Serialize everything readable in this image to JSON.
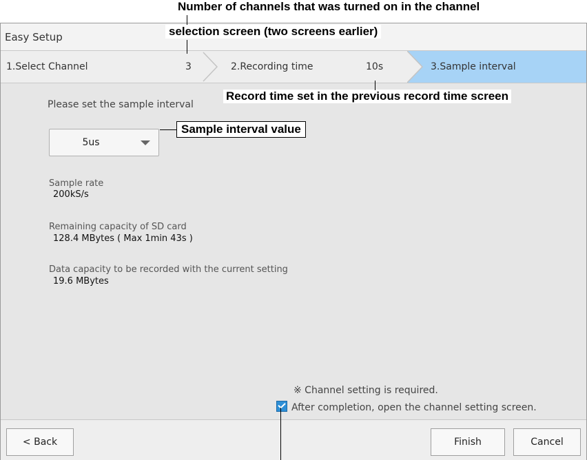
{
  "window": {
    "title": "Easy Setup"
  },
  "steps": [
    {
      "label": "1.Select Channel",
      "value": "3"
    },
    {
      "label": "2.Recording time",
      "value": "10s"
    },
    {
      "label": "3.Sample interval",
      "value": ""
    }
  ],
  "main": {
    "prompt": "Please set the sample interval",
    "sample_interval": {
      "selected": "5us"
    },
    "sample_rate": {
      "label": "Sample rate",
      "value": "200kS/s"
    },
    "sd_capacity": {
      "label": "Remaining capacity of SD card",
      "value": "128.4 MBytes ( Max 1min 43s )"
    },
    "data_capacity": {
      "label": "Data capacity to be recorded with the current setting",
      "value": "19.6 MBytes"
    },
    "note": "※ Channel setting is required.",
    "open_channel_setting": {
      "label": "After completion, open the channel setting screen.",
      "checked": true
    }
  },
  "footer": {
    "back_label": "< Back",
    "finish_label": "Finish",
    "cancel_label": "Cancel"
  },
  "annotations": {
    "channels_note_line1": "Number of channels that was turned on in the channel",
    "channels_note_line2": "selection screen (two screens earlier)",
    "record_time_note": "Record time set in the previous record time screen",
    "sample_interval_note": "Sample interval value"
  },
  "colors": {
    "active_step": "#a7d3f6",
    "checkbox": "#2e8fd6",
    "panel": "#e6e6e6"
  }
}
